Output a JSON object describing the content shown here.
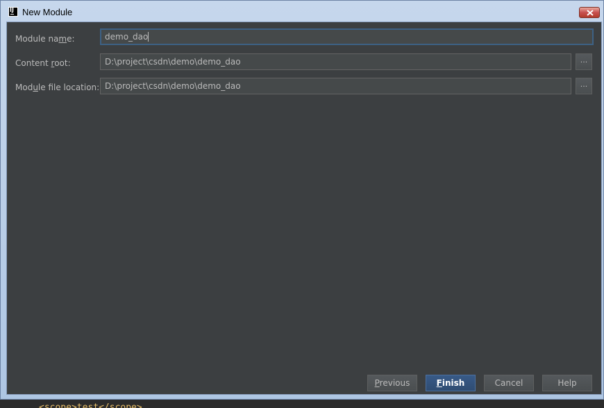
{
  "window": {
    "title": "New Module",
    "app_icon": "intellij-idea-icon",
    "close_icon": "close-icon"
  },
  "form": {
    "module_name": {
      "label_pre": "Module na",
      "label_u": "m",
      "label_post": "e:",
      "value": "demo_dao"
    },
    "content_root": {
      "label_pre": "Content ",
      "label_u": "r",
      "label_post": "oot:",
      "value": "D:\\project\\csdn\\demo\\demo_dao",
      "browse_label": "..."
    },
    "module_file_location": {
      "label_pre": "Mod",
      "label_u": "u",
      "label_post": "le file location:",
      "value": "D:\\project\\csdn\\demo\\demo_dao",
      "browse_label": "..."
    }
  },
  "buttons": {
    "previous_u": "P",
    "previous_rest": "revious",
    "finish_u": "F",
    "finish_rest": "inish",
    "cancel": "Cancel",
    "help": "Help"
  },
  "background": {
    "code_snippet": "<scope>test</scope>"
  }
}
